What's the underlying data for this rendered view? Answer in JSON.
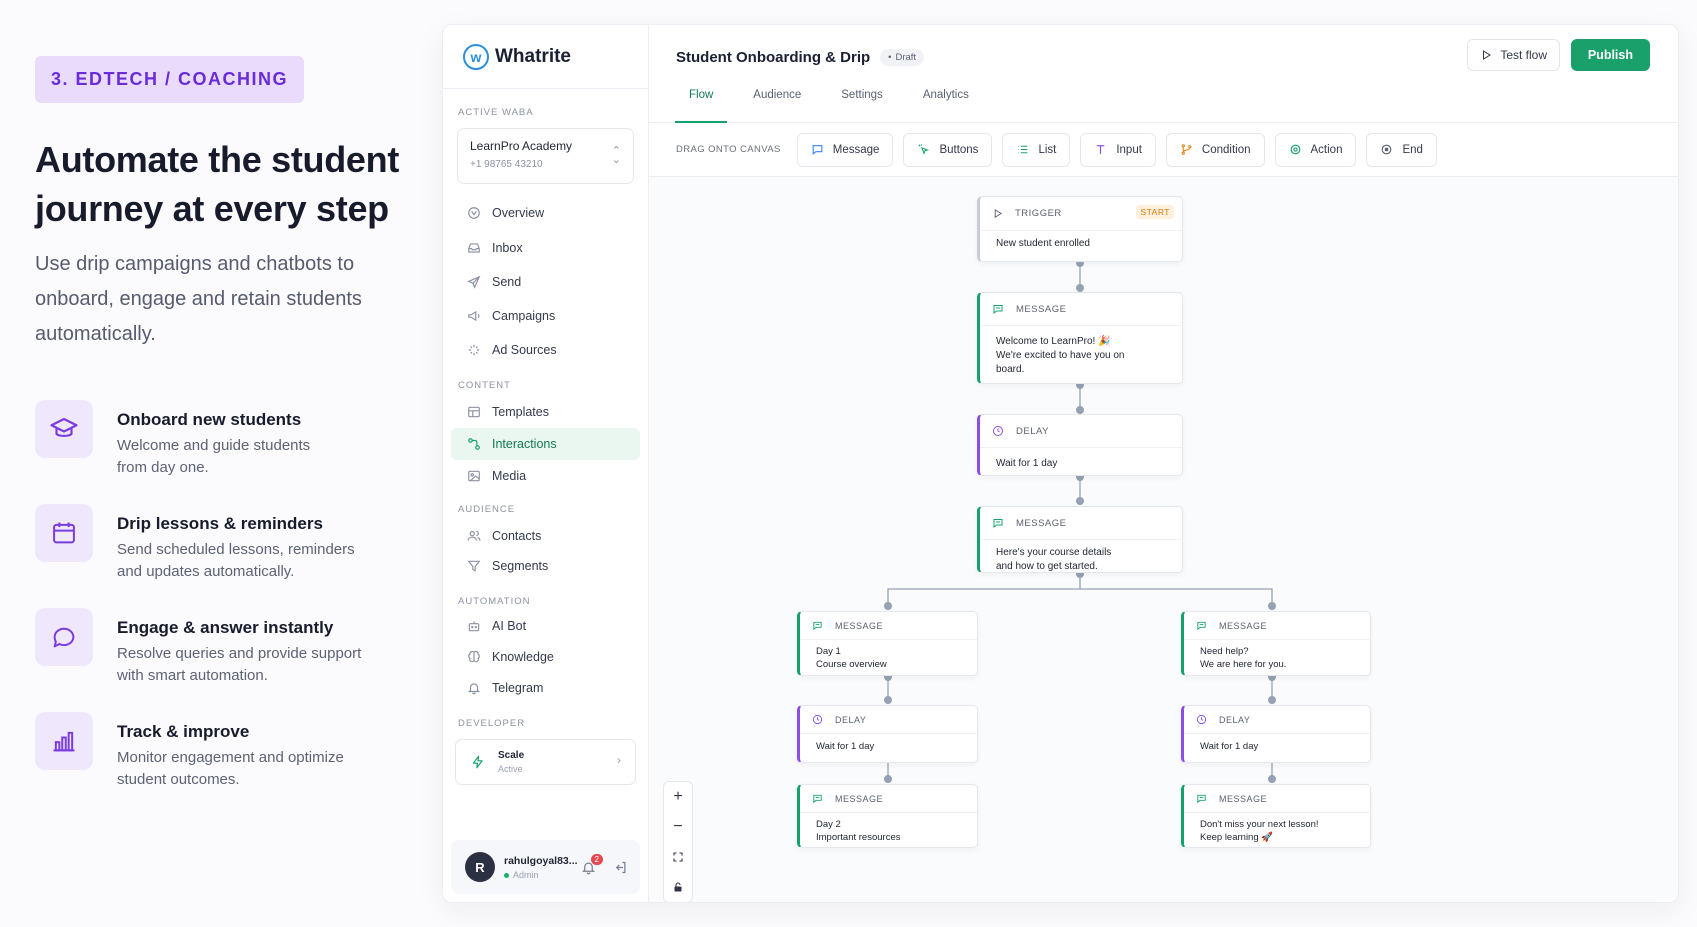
{
  "hero": {
    "eyebrow": "3. EDTECH / COACHING",
    "title": "Automate the student journey at every step",
    "subtitle": "Use drip campaigns and chatbots to onboard, engage and retain students automatically."
  },
  "features": [
    {
      "title": "Onboard new students",
      "desc": "Welcome and guide students\nfrom day one.",
      "icon": "graduation-cap-icon"
    },
    {
      "title": "Drip lessons & reminders",
      "desc": "Send scheduled lessons, reminders\nand updates automatically.",
      "icon": "calendar-icon"
    },
    {
      "title": "Engage & answer instantly",
      "desc": "Resolve queries and provide support\nwith smart automation.",
      "icon": "chat-bubble-icon"
    },
    {
      "title": "Track & improve",
      "desc": "Monitor engagement and optimize\nstudent outcomes.",
      "icon": "bar-chart-icon"
    }
  ],
  "sidebar": {
    "brand": "Whatrite",
    "active_waba_label": "ACTIVE WABA",
    "waba_name": "LearnPro Academy",
    "waba_phone": "+1 98765 43210",
    "main_items": [
      {
        "label": "Overview",
        "icon": "overview-icon"
      },
      {
        "label": "Inbox",
        "icon": "inbox-icon"
      },
      {
        "label": "Send",
        "icon": "send-icon"
      },
      {
        "label": "Campaigns",
        "icon": "megaphone-icon"
      },
      {
        "label": "Ad Sources",
        "icon": "sparkle-icon"
      }
    ],
    "content_label": "CONTENT",
    "content_items": [
      {
        "label": "Templates",
        "icon": "template-icon"
      },
      {
        "label": "Interactions",
        "icon": "interactions-icon",
        "active": true
      },
      {
        "label": "Media",
        "icon": "image-icon"
      }
    ],
    "audience_label": "AUDIENCE",
    "audience_items": [
      {
        "label": "Contacts",
        "icon": "users-icon"
      },
      {
        "label": "Segments",
        "icon": "filter-icon"
      }
    ],
    "automation_label": "AUTOMATION",
    "automation_items": [
      {
        "label": "AI Bot",
        "icon": "bot-icon"
      },
      {
        "label": "Knowledge",
        "icon": "brain-icon"
      },
      {
        "label": "Telegram",
        "icon": "bell-icon"
      }
    ],
    "developer_label": "DEVELOPER",
    "scale_name": "Scale",
    "scale_state": "Active",
    "user_initial": "R",
    "user_name": "rahulgoyal83...",
    "user_role": "Admin",
    "notif_count": "2"
  },
  "header": {
    "flow_title": "Student Onboarding & Drip",
    "status": "Draft",
    "test_label": "Test flow",
    "publish_label": "Publish"
  },
  "tabs": [
    "Flow",
    "Audience",
    "Settings",
    "Analytics"
  ],
  "palette": {
    "label": "DRAG ONTO CANVAS",
    "items": [
      {
        "label": "Message",
        "icon": "message-icon",
        "color": "#3b82f6"
      },
      {
        "label": "Buttons",
        "icon": "pointer-icon",
        "color": "#18a06c"
      },
      {
        "label": "List",
        "icon": "list-icon",
        "color": "#18a06c"
      },
      {
        "label": "Input",
        "icon": "text-input-icon",
        "color": "#8b4fe3"
      },
      {
        "label": "Condition",
        "icon": "branch-icon",
        "color": "#e08a1e"
      },
      {
        "label": "Action",
        "icon": "target-icon",
        "color": "#18a06c"
      },
      {
        "label": "End",
        "icon": "stop-icon",
        "color": "#5b6172"
      }
    ]
  },
  "nodes": {
    "trigger": {
      "type": "TRIGGER",
      "tag": "START",
      "text": "New student enrolled"
    },
    "welcome": {
      "type": "MESSAGE",
      "text": "Welcome to LearnPro! 🎉\nWe're excited to have you on\nboard."
    },
    "delay_main": {
      "type": "DELAY",
      "text": "Wait for 1 day"
    },
    "course_details": {
      "type": "MESSAGE",
      "text": "Here's your course details\nand how to get started."
    },
    "left_msg1": {
      "type": "MESSAGE",
      "text": "Day 1\nCourse overview"
    },
    "left_delay": {
      "type": "DELAY",
      "text": "Wait for 1 day"
    },
    "left_msg2": {
      "type": "MESSAGE",
      "text": "Day 2\nImportant resources"
    },
    "right_msg1": {
      "type": "MESSAGE",
      "text": "Need help?\nWe are here for you."
    },
    "right_delay": {
      "type": "DELAY",
      "text": "Wait for 1 day"
    },
    "right_msg2": {
      "type": "MESSAGE",
      "text": "Don't miss your next lesson!\nKeep learning 🚀"
    }
  },
  "colors": {
    "accent": "#18a06c",
    "brand_purple": "#6a2bd9",
    "delay_purple": "#8b4fe3"
  }
}
